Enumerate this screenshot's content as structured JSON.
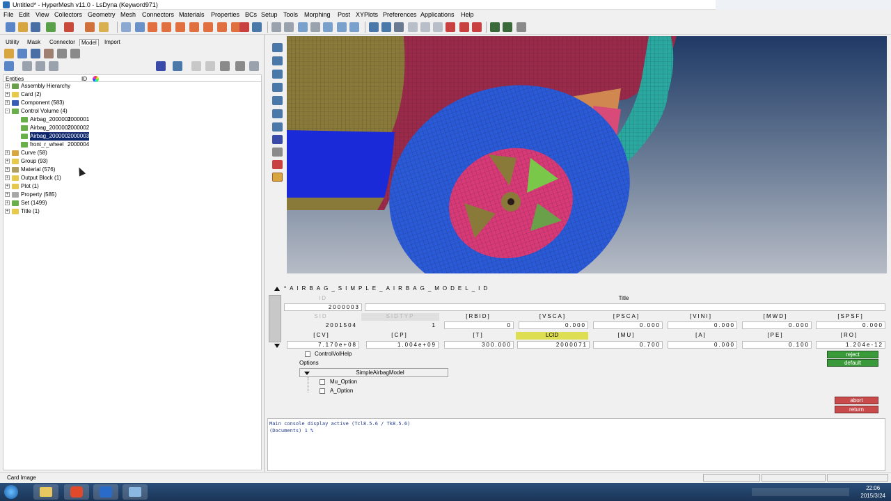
{
  "window": {
    "title": "Untitled* - HyperMesh v11.0 - LsDyna (Keyword971)"
  },
  "menu": [
    "File",
    "Edit",
    "View",
    "Collectors",
    "Geometry",
    "Mesh",
    "Connectors",
    "Materials",
    "Properties",
    "BCs",
    "Setup",
    "Tools",
    "Morphing",
    "Post",
    "XYPlots",
    "Preferences",
    "Applications",
    "Help"
  ],
  "tabs": [
    "Utility",
    "Mask",
    "Connector",
    "Model",
    "Import"
  ],
  "browser": {
    "headers": {
      "entities": "Entities",
      "id": "ID"
    },
    "rows": [
      {
        "label": "Assembly Hierarchy",
        "id": ""
      },
      {
        "label": "Card (2)",
        "id": ""
      },
      {
        "label": "Component (583)",
        "id": ""
      },
      {
        "label": "Control Volume (4)",
        "id": ""
      },
      {
        "label": "Airbag_2000001",
        "id": "2000001"
      },
      {
        "label": "Airbag_2000002",
        "id": "2000002"
      },
      {
        "label": "Airbag_2000003",
        "id": "2000003"
      },
      {
        "label": "front_r_wheel",
        "id": "2000004"
      },
      {
        "label": "Curve (58)",
        "id": ""
      },
      {
        "label": "Group (93)",
        "id": ""
      },
      {
        "label": "Material (576)",
        "id": ""
      },
      {
        "label": "Output Block (1)",
        "id": ""
      },
      {
        "label": "Plot (1)",
        "id": ""
      },
      {
        "label": "Property (585)",
        "id": ""
      },
      {
        "label": "Set (1499)",
        "id": ""
      },
      {
        "label": "Title (1)",
        "id": ""
      }
    ]
  },
  "card": {
    "keyword": "*AIRBAG_SIMPLE_AIRBAG_MODEL_ID",
    "row1": {
      "id_label": "ID",
      "title_label": "Title",
      "id_value": "2000003",
      "title_value": ""
    },
    "row2": {
      "labels": [
        "SID",
        "SIDTYP",
        "[RBID]",
        "[VSCA]",
        "[PSCA]",
        "[VINI]",
        "[MWD]",
        "[SPSF]"
      ],
      "values": [
        "2001504",
        "1",
        "0",
        "0.000",
        "0.000",
        "0.000",
        "0.000",
        "0.000"
      ]
    },
    "row3": {
      "labels": [
        "[CV]",
        "[CP]",
        "[T]",
        "LCID",
        "[MU]",
        "[A]",
        "[PE]",
        "[RO]"
      ],
      "values": [
        "7.170e+08",
        "1.004e+09",
        "300.000",
        "2000071",
        "0.700",
        "0.000",
        "0.100",
        "1.204e-12"
      ]
    },
    "help": "ControlVolHelp",
    "options_label": "Options",
    "model_select": "SimpleAirbagModel",
    "opt1": "Mu_Option",
    "opt2": "A_Option",
    "buttons": {
      "reject": "reject",
      "default": "default",
      "abort": "abort",
      "return": "return"
    }
  },
  "console": {
    "line1": "Main console display active (Tcl8.5.6 / Tk8.5.6)",
    "line2": "(Documents) 1 %"
  },
  "status": {
    "text": "Card Image"
  },
  "clock": {
    "time": "22:06",
    "date": "2015/3/24"
  }
}
